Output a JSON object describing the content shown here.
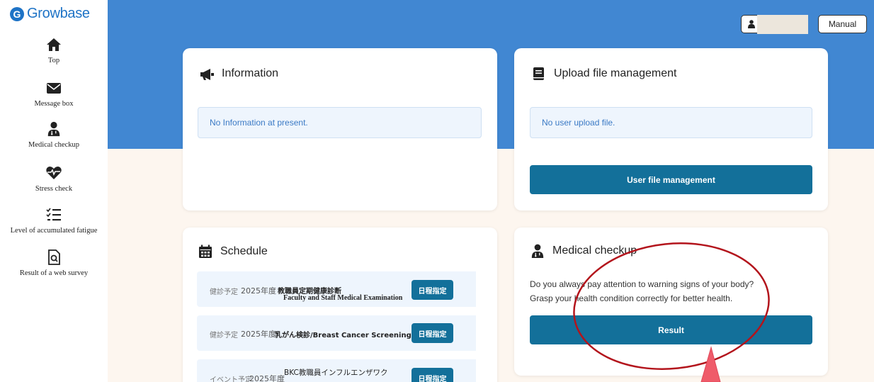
{
  "brand": {
    "name": "Growbase",
    "logo_letter": "G"
  },
  "sidebar": {
    "items": [
      {
        "label": "Top",
        "icon": "home-icon"
      },
      {
        "label": "Message box",
        "icon": "envelope-icon"
      },
      {
        "label": "Medical checkup",
        "icon": "doctor-icon"
      },
      {
        "label": "Stress check",
        "icon": "heartbeat-icon"
      },
      {
        "label": "Level of accumulated fatigue",
        "icon": "checklist-icon"
      },
      {
        "label": "Result of a web survey",
        "icon": "survey-doc-icon"
      }
    ]
  },
  "header": {
    "manual_label": "Manual",
    "user_icon": "user-icon"
  },
  "information": {
    "title": "Information",
    "icon": "megaphone-icon",
    "notice": "No Information at present."
  },
  "upload": {
    "title": "Upload file management",
    "icon": "book-icon",
    "notice": "No user upload file.",
    "button": "User file management"
  },
  "schedule": {
    "title": "Schedule",
    "icon": "calendar-icon",
    "items": [
      {
        "tag": "健診予定",
        "year": "2025年度",
        "title": "教職員定期健康診断",
        "subtitle": "Faculty and Staff Medical Examination",
        "button": "日程指定"
      },
      {
        "tag": "健診予定",
        "year": "2025年度",
        "title": "乳がん検診/Breast Cancer Screening",
        "subtitle": "",
        "button": "日程指定"
      },
      {
        "tag": "イベント予定",
        "year": "2025年度",
        "title": "BKC教職員インフルエンザワク",
        "subtitle": "",
        "button": "日程指定"
      }
    ]
  },
  "medical": {
    "title": "Medical checkup",
    "icon": "doctor-icon",
    "desc_line1": "Do you always pay attention to warning signs of your body?",
    "desc_line2": "Grasp your health condition correctly for better health.",
    "button": "Result"
  },
  "colors": {
    "header_blue": "#4187d2",
    "primary_button": "#13709a",
    "notice_bg": "#eef5fd",
    "notice_text": "#3b7ac5",
    "annotation_red": "#b3141c",
    "arrow_pink": "#ef5b6a"
  }
}
